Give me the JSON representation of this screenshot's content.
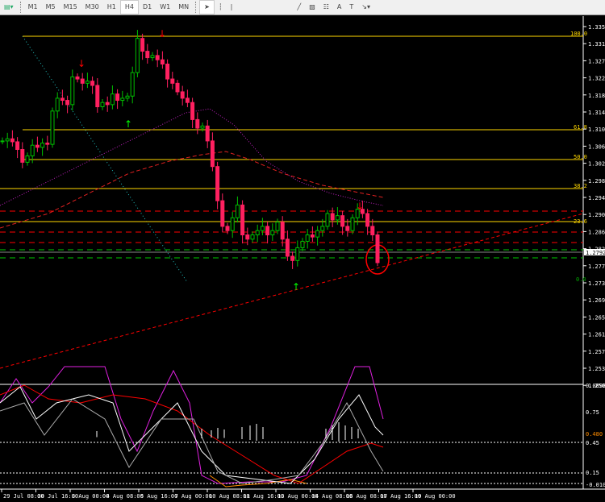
{
  "toolbar": {
    "timeframes": [
      "M1",
      "M5",
      "M15",
      "M30",
      "H1",
      "H4",
      "D1",
      "W1",
      "MN"
    ],
    "active": "H4",
    "tools": [
      "cursor-icon",
      "crosshair-icon",
      "vertical-line-icon",
      "horizontal-line-icon",
      "trendline-icon",
      "channel-icon",
      "fibonacci-icon",
      "text-icon",
      "label-icon",
      "arrow-icon"
    ]
  },
  "price_axis": [
    "1.33510",
    "1.33100",
    "1.32700",
    "1.32290",
    "1.31890",
    "1.31490",
    "1.31030",
    "1.30630",
    "1.30230",
    "1.29810",
    "1.29410",
    "1.29000",
    "1.28600",
    "1.28200",
    "1.27790",
    "1.27390",
    "1.26990",
    "1.26590",
    "1.26180",
    "1.25780",
    "1.25380",
    "1.25030"
  ],
  "current_price": "1.27928",
  "fib_levels": [
    "100.0",
    "61.8",
    "50.0",
    "38.2",
    "23.6",
    "0.0"
  ],
  "indicator_axis": [
    "0.009832",
    "0.75",
    "0.480",
    "0.45",
    "0.15",
    "-0.01057"
  ],
  "time_axis": [
    "29 Jul 08:00",
    "30 Jul 16:00",
    "3 Aug 00:00",
    "4 Aug 08:00",
    "5 Aug 16:00",
    "7 Aug 00:00",
    "10 Aug 08:00",
    "11 Aug 16:00",
    "13 Aug 00:00",
    "14 Aug 08:00",
    "16 Aug 08:00",
    "17 Aug 16:00",
    "19 Aug 00:00"
  ],
  "colors": {
    "bull": "#00c000",
    "bear": "#ff2060",
    "fib": "#ffd700",
    "resistance": "#ff0000",
    "support": "#00c000"
  },
  "chart_data": {
    "type": "candlestick",
    "closes": [
      1.308,
      1.3085,
      1.3078,
      1.306,
      1.303,
      1.3045,
      1.307,
      1.3065,
      1.3075,
      1.3072,
      1.315,
      1.318,
      1.3175,
      1.3165,
      1.323,
      1.3225,
      1.3215,
      1.322,
      1.321,
      1.316,
      1.317,
      1.3165,
      1.319,
      1.3175,
      1.318,
      1.3185,
      1.324,
      1.332,
      1.329,
      1.3275,
      1.328,
      1.327,
      1.326,
      1.3225,
      1.3215,
      1.3195,
      1.318,
      1.317,
      1.313,
      1.311,
      1.3115,
      1.308,
      1.302,
      1.294,
      1.288,
      1.287,
      1.29,
      1.293,
      1.286,
      1.285,
      1.286,
      1.287,
      1.288,
      1.286,
      1.287,
      1.289,
      1.285,
      1.281,
      1.28,
      1.283,
      1.2845,
      1.286,
      1.2855,
      1.287,
      1.288,
      1.291,
      1.2895,
      1.2905,
      1.288,
      1.287,
      1.29,
      1.292,
      1.291,
      1.288,
      1.286,
      1.2795
    ]
  }
}
